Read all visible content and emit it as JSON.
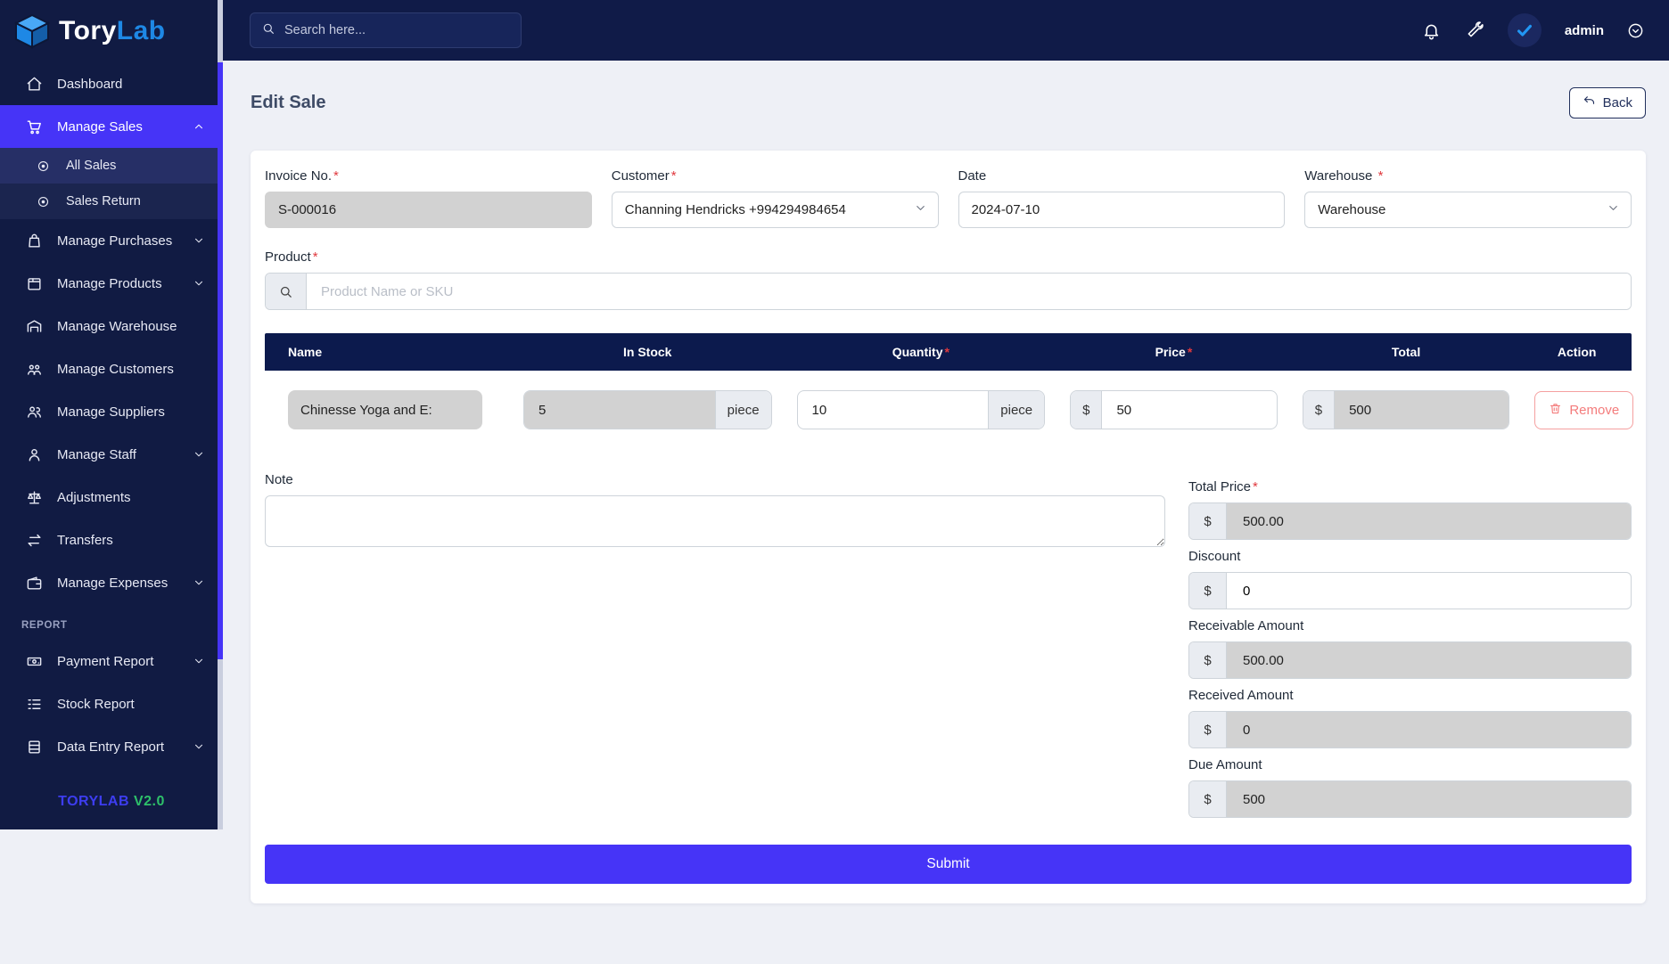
{
  "required_mark": "*",
  "brand": {
    "logo_text_1": "Tory",
    "logo_text_2": "Lab"
  },
  "topbar": {
    "search_placeholder": "Search here...",
    "username": "admin"
  },
  "sidebar": {
    "items": [
      {
        "label": "Dashboard"
      },
      {
        "label": "Manage Sales"
      },
      {
        "label": "All Sales"
      },
      {
        "label": "Sales Return"
      },
      {
        "label": "Manage Purchases"
      },
      {
        "label": "Manage Products"
      },
      {
        "label": "Manage Warehouse"
      },
      {
        "label": "Manage Customers"
      },
      {
        "label": "Manage Suppliers"
      },
      {
        "label": "Manage Staff"
      },
      {
        "label": "Adjustments"
      },
      {
        "label": "Transfers"
      },
      {
        "label": "Manage Expenses"
      }
    ],
    "section_label": "REPORT",
    "report_items": [
      {
        "label": "Payment Report"
      },
      {
        "label": "Stock Report"
      },
      {
        "label": "Data Entry Report"
      }
    ],
    "footer": {
      "name": "TORYLAB",
      "version": "V2.0"
    }
  },
  "page": {
    "title": "Edit Sale",
    "back_label": "Back"
  },
  "form": {
    "invoice": {
      "label": "Invoice No.",
      "value": "S-000016"
    },
    "customer": {
      "label": "Customer",
      "value": "Channing Hendricks +994294984654"
    },
    "date": {
      "label": "Date",
      "value": "2024-07-10"
    },
    "warehouse": {
      "label": "Warehouse",
      "value": "Warehouse"
    },
    "product": {
      "label": "Product",
      "placeholder": "Product Name or SKU"
    },
    "note": {
      "label": "Note",
      "value": ""
    },
    "submit_label": "Submit"
  },
  "table": {
    "headers": [
      "Name",
      "In Stock",
      "Quantity",
      "Price",
      "Total",
      "Action"
    ],
    "currency": "$",
    "row": {
      "name": "Chinesse Yoga and E:",
      "in_stock": "5",
      "in_stock_unit": "piece",
      "quantity": "10",
      "quantity_unit": "piece",
      "price": "50",
      "total": "500",
      "remove_label": "Remove"
    }
  },
  "totals": {
    "currency": "$",
    "total_price": {
      "label": "Total Price",
      "value": "500.00"
    },
    "discount": {
      "label": "Discount",
      "value": "0"
    },
    "receivable": {
      "label": "Receivable Amount",
      "value": "500.00"
    },
    "received": {
      "label": "Received Amount",
      "value": "0"
    },
    "due": {
      "label": "Due Amount",
      "value": "500"
    }
  },
  "colors": {
    "accent": "#4634f7",
    "sidebar_bg": "#111b43",
    "topbar_bg": "#101b48",
    "table_header_bg": "#0c1a4d",
    "disabled_input": "#d2d2d2",
    "remove_red": "#f47c7c",
    "logo_blue": "#1e88e5",
    "version_green": "#2ec06a",
    "version_blue": "#3d3df0"
  }
}
